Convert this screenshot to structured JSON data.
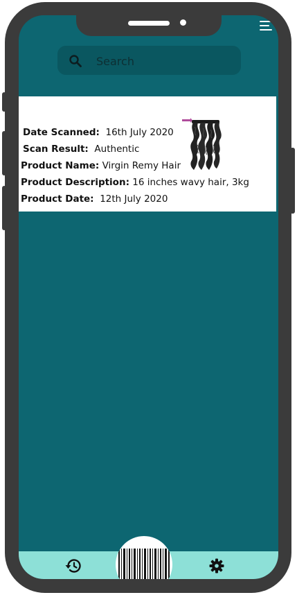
{
  "search": {
    "placeholder": "Search"
  },
  "scan_result": {
    "date_scanned_label": "Date Scanned:",
    "date_scanned_value": "16th July 2020",
    "scan_result_label": "Scan Result:",
    "scan_result_value": "Authentic",
    "product_name_label": "Product Name:",
    "product_name_value": "Virgin Remy Hair",
    "product_description_label": "Product Description:",
    "product_description_value": "16 inches wavy hair, 3kg",
    "product_date_label": "Product Date:",
    "product_date_value": "12th July 2020"
  },
  "nav": {
    "history_icon": "history-icon",
    "scan_icon": "barcode-icon",
    "settings_icon": "gear-icon"
  },
  "colors": {
    "screen_bg": "#0d6671",
    "search_bg": "#0a5760",
    "card_bg": "#ffffff",
    "nav_bg": "#8de0d7",
    "frame": "#3b3b3b"
  }
}
